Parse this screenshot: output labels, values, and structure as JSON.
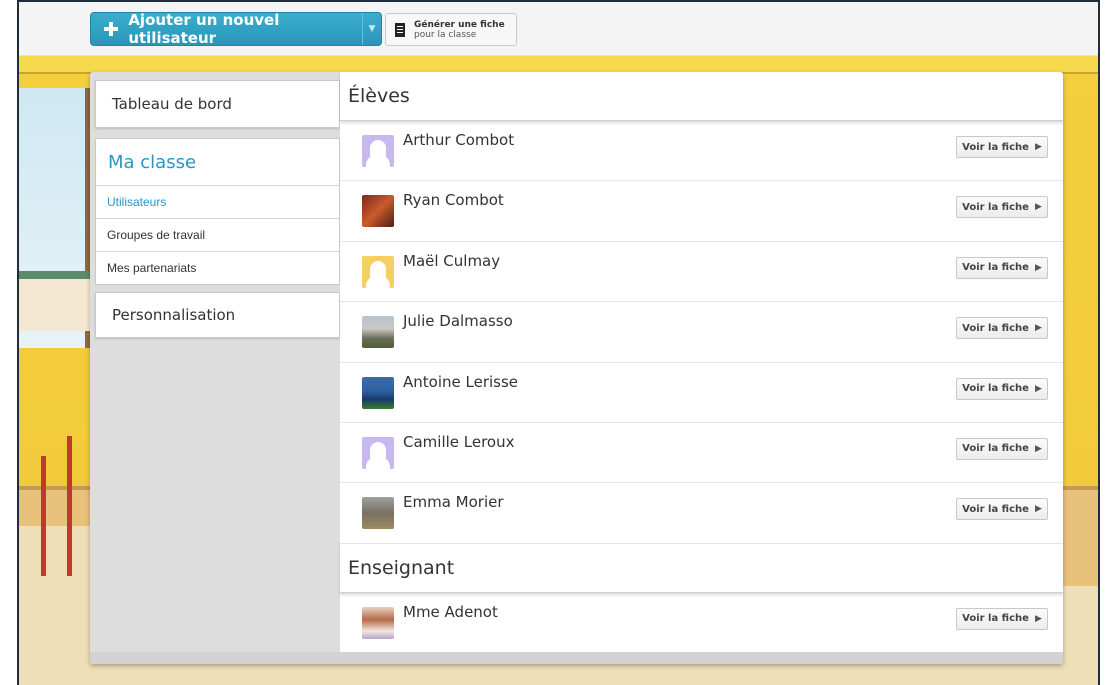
{
  "toolbar": {
    "add_user_label": "Ajouter un nouvel utilisateur",
    "generate_line1": "Générer une fiche",
    "generate_line2": "pour la classe"
  },
  "sidebar": {
    "dashboard": "Tableau de bord",
    "ma_classe": "Ma classe",
    "sub_items": [
      "Utilisateurs",
      "Groupes de travail",
      "Mes partenariats"
    ],
    "personnalisation": "Personnalisation"
  },
  "sections": {
    "eleves_title": "Élèves",
    "enseignant_title": "Enseignant"
  },
  "eleves": [
    {
      "name": "Arthur Combot",
      "avatar": "silhouette-lilac"
    },
    {
      "name": "Ryan Combot",
      "avatar": "photo"
    },
    {
      "name": "Maël Culmay",
      "avatar": "silhouette-yellow"
    },
    {
      "name": "Julie Dalmasso",
      "avatar": "photo"
    },
    {
      "name": "Antoine Lerisse",
      "avatar": "photo"
    },
    {
      "name": "Camille Leroux",
      "avatar": "silhouette-lilac"
    },
    {
      "name": "Emma Morier",
      "avatar": "photo"
    }
  ],
  "enseignants": [
    {
      "name": "Mme Adenot",
      "avatar": "photo"
    }
  ],
  "voir_label": "Voir la fiche",
  "colors": {
    "accent": "#2a95c7",
    "add_button": "#3aaecd",
    "background_wall": "#f3cf3c"
  }
}
